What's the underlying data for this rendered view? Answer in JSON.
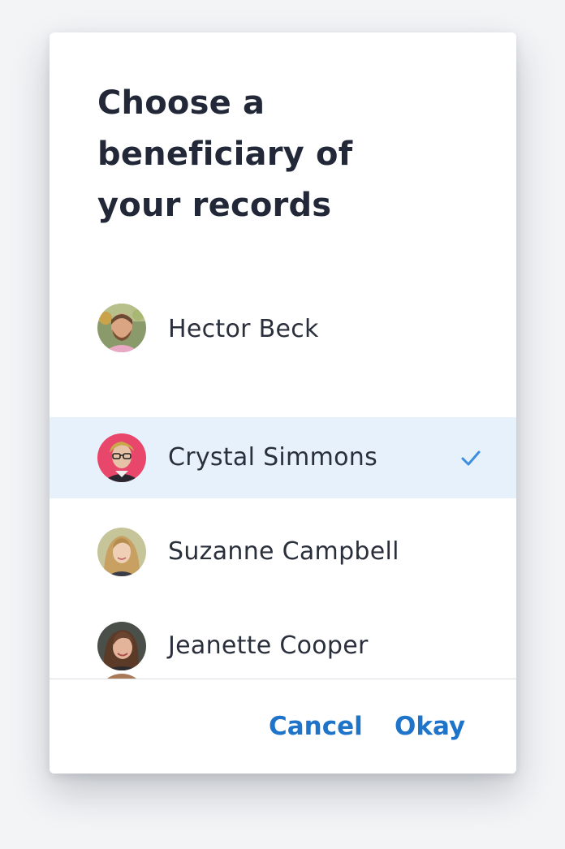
{
  "dialog": {
    "title": "Choose a beneficiary of your records"
  },
  "list": {
    "items": [
      {
        "name": "Hector Beck",
        "avatar": "hector-avatar",
        "selected": false
      },
      {
        "name": "Crystal Simmons",
        "avatar": "crystal-avatar",
        "selected": true
      },
      {
        "name": "Suzanne Campbell",
        "avatar": "suzanne-avatar",
        "selected": false
      },
      {
        "name": "Jeanette Cooper",
        "avatar": "jeanette-avatar",
        "selected": false
      }
    ],
    "selected_icon": "check-icon"
  },
  "footer": {
    "cancel_label": "Cancel",
    "okay_label": "Okay"
  },
  "colors": {
    "accent": "#1e74c8",
    "selected_row": "#e7f1fc",
    "check": "#3d8ee0",
    "title": "#222838",
    "text": "#2a2f3c",
    "background": "#f3f4f6"
  }
}
